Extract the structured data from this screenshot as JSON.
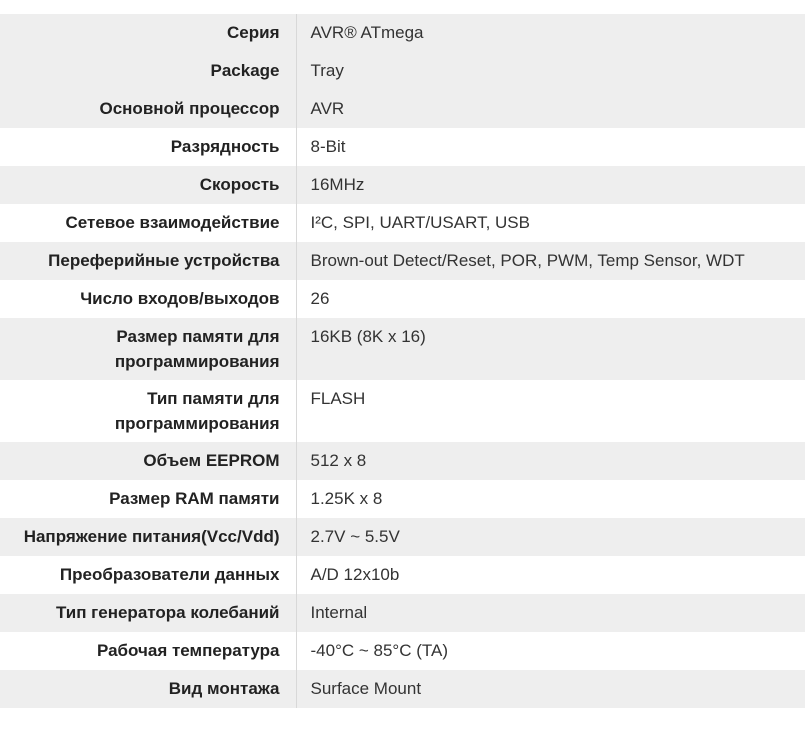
{
  "specs": [
    {
      "label": "Серия",
      "value": "AVR® ATmega"
    },
    {
      "label": "Package",
      "value": "Tray"
    },
    {
      "label": "Основной процессор",
      "value": "AVR"
    },
    {
      "label": "Разрядность",
      "value": "8-Bit"
    },
    {
      "label": "Скорость",
      "value": "16MHz"
    },
    {
      "label": "Сетевое взаимодействие",
      "value": "I²C, SPI, UART/USART, USB"
    },
    {
      "label": "Переферийные устройства",
      "value": "Brown-out Detect/Reset, POR, PWM, Temp Sensor, WDT"
    },
    {
      "label": "Число входов/выходов",
      "value": "26"
    },
    {
      "label": "Размер памяти для программирования",
      "value": "16KB (8K x 16)"
    },
    {
      "label": "Тип памяти для программирования",
      "value": "FLASH"
    },
    {
      "label": "Объем EEPROM",
      "value": "512 x 8"
    },
    {
      "label": "Размер RAM памяти",
      "value": "1.25K x 8"
    },
    {
      "label": "Напряжение питания(Vcc/Vdd)",
      "value": "2.7V ~ 5.5V"
    },
    {
      "label": "Преобразователи данных",
      "value": "A/D 12x10b"
    },
    {
      "label": "Тип генератора колебаний",
      "value": "Internal"
    },
    {
      "label": "Рабочая температура",
      "value": "-40°C ~ 85°C (TA)"
    },
    {
      "label": "Вид монтажа",
      "value": "Surface Mount"
    }
  ]
}
